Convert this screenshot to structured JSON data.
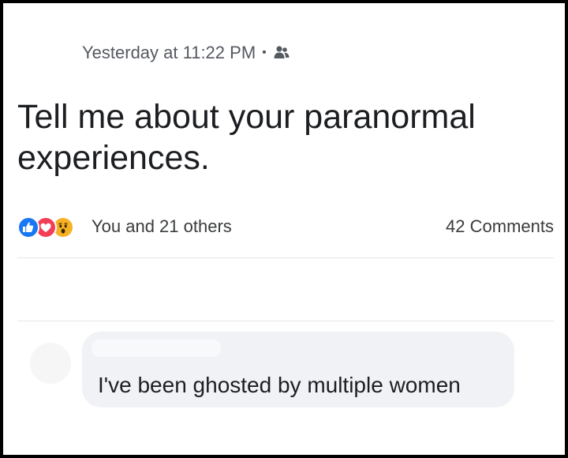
{
  "post": {
    "timestamp": "Yesterday at 11:22 PM",
    "separator": "•",
    "audience_icon": "friends-icon",
    "text": "Tell me about your paranormal experiences."
  },
  "reactions": {
    "icons": [
      "like-icon",
      "love-icon",
      "wow-icon"
    ],
    "summary": "You and 21 others"
  },
  "comments": {
    "count_label": "42 Comments",
    "items": [
      {
        "text": "I've been ghosted by multiple women"
      }
    ]
  },
  "colors": {
    "like": "#1877f2",
    "love": "#f33e58",
    "wow": "#f7b125",
    "text": "#1c1e21",
    "muted": "#555a60",
    "bubble": "#f0f2f5"
  }
}
